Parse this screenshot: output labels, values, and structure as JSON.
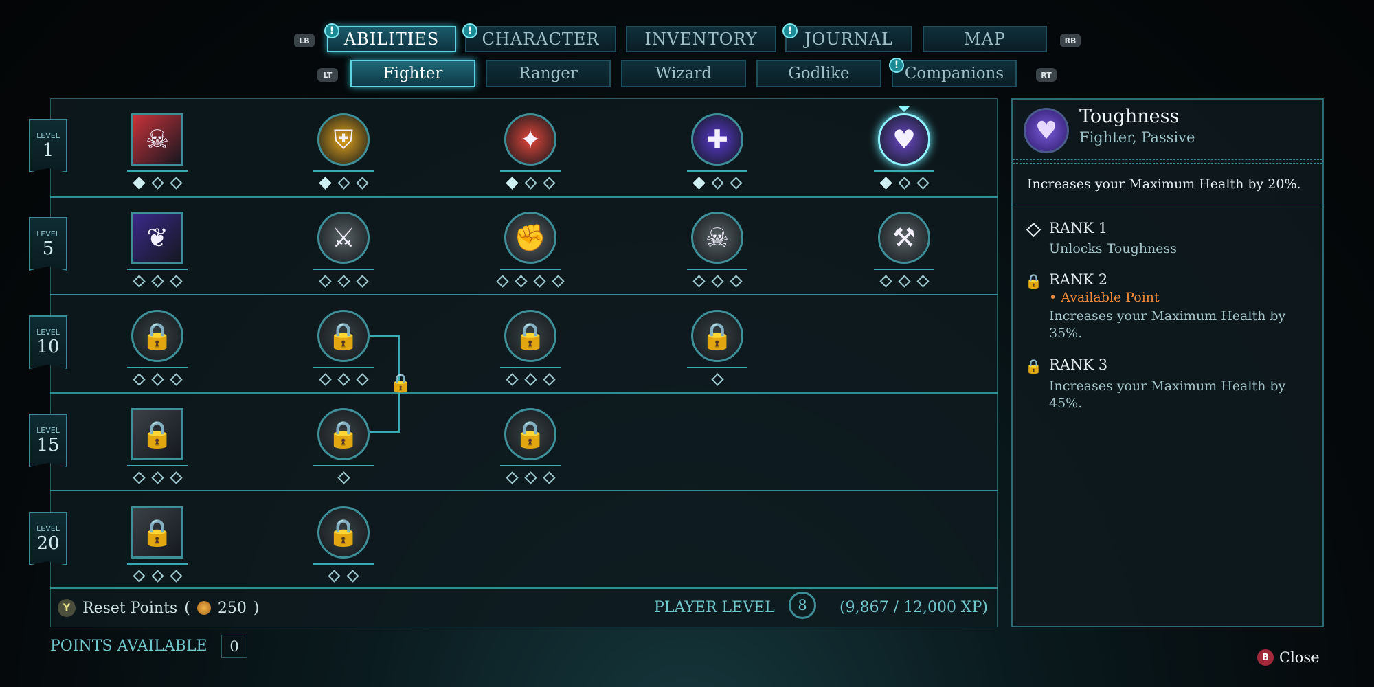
{
  "nav": {
    "left_shoulder": "LB",
    "right_shoulder": "RB",
    "left_trigger": "LT",
    "right_trigger": "RT",
    "main_tabs": [
      {
        "label": "ABILITIES",
        "active": true,
        "alert": true
      },
      {
        "label": "CHARACTER",
        "active": false,
        "alert": true
      },
      {
        "label": "INVENTORY",
        "active": false,
        "alert": false
      },
      {
        "label": "JOURNAL",
        "active": false,
        "alert": true
      },
      {
        "label": "MAP",
        "active": false,
        "alert": false
      }
    ],
    "sub_tabs": [
      {
        "label": "Fighter",
        "active": true,
        "alert": false
      },
      {
        "label": "Ranger",
        "active": false,
        "alert": false
      },
      {
        "label": "Wizard",
        "active": false,
        "alert": false
      },
      {
        "label": "Godlike",
        "active": false,
        "alert": false
      },
      {
        "label": "Companions",
        "active": false,
        "alert": true
      }
    ],
    "alert_glyph": "!"
  },
  "levels": [
    {
      "label": "LEVEL",
      "value": "1"
    },
    {
      "label": "LEVEL",
      "value": "5"
    },
    {
      "label": "LEVEL",
      "value": "10"
    },
    {
      "label": "LEVEL",
      "value": "15"
    },
    {
      "label": "LEVEL",
      "value": "20"
    }
  ],
  "abilities": [
    {
      "row": 0,
      "col": 0,
      "icon": "demon-mask-icon",
      "shape": "square",
      "locked": false,
      "ranks": 3,
      "filled": 1,
      "color": "#c8323a"
    },
    {
      "row": 0,
      "col": 1,
      "icon": "golden-shield-icon",
      "shape": "circle",
      "locked": false,
      "ranks": 3,
      "filled": 1,
      "color": "#e0a21c"
    },
    {
      "row": 0,
      "col": 2,
      "icon": "shield-bash-icon",
      "shape": "circle",
      "locked": false,
      "ranks": 3,
      "filled": 1,
      "color": "#e0453a"
    },
    {
      "row": 0,
      "col": 3,
      "icon": "purple-crosses-icon",
      "shape": "circle",
      "locked": false,
      "ranks": 3,
      "filled": 1,
      "color": "#5a3ad0"
    },
    {
      "row": 0,
      "col": 4,
      "icon": "heart-icon",
      "shape": "circle",
      "locked": false,
      "ranks": 3,
      "filled": 1,
      "color": "#6a4ac8",
      "selected": true
    },
    {
      "row": 1,
      "col": 0,
      "icon": "purple-beast-icon",
      "shape": "square",
      "locked": false,
      "ranks": 3,
      "filled": 0,
      "color": "#3a2a8a"
    },
    {
      "row": 1,
      "col": 1,
      "icon": "axe-cleave-icon",
      "shape": "circle",
      "locked": false,
      "ranks": 3,
      "filled": 0,
      "color": "#5a6266"
    },
    {
      "row": 1,
      "col": 2,
      "icon": "fist-icon",
      "shape": "circle",
      "locked": false,
      "ranks": 4,
      "filled": 0,
      "color": "#5a6266"
    },
    {
      "row": 1,
      "col": 3,
      "icon": "skull-icon",
      "shape": "circle",
      "locked": false,
      "ranks": 3,
      "filled": 0,
      "color": "#5a6266"
    },
    {
      "row": 1,
      "col": 4,
      "icon": "war-axe-icon",
      "shape": "circle",
      "locked": false,
      "ranks": 3,
      "filled": 0,
      "color": "#5a6266"
    },
    {
      "row": 2,
      "col": 0,
      "icon": "lock-icon",
      "shape": "circle",
      "locked": true,
      "ranks": 3,
      "filled": 0,
      "color": "#3a4246"
    },
    {
      "row": 2,
      "col": 1,
      "icon": "lock-icon",
      "shape": "circle",
      "locked": true,
      "ranks": 3,
      "filled": 0,
      "color": "#3a4246"
    },
    {
      "row": 2,
      "col": 2,
      "icon": "lock-icon",
      "shape": "circle",
      "locked": true,
      "ranks": 3,
      "filled": 0,
      "color": "#3a4246"
    },
    {
      "row": 2,
      "col": 3,
      "icon": "lock-icon",
      "shape": "circle",
      "locked": true,
      "ranks": 1,
      "filled": 0,
      "color": "#3a4246"
    },
    {
      "row": 3,
      "col": 0,
      "icon": "lock-icon",
      "shape": "square",
      "locked": true,
      "ranks": 3,
      "filled": 0,
      "color": "#3a4246"
    },
    {
      "row": 3,
      "col": 1,
      "icon": "lock-icon",
      "shape": "circle",
      "locked": true,
      "ranks": 1,
      "filled": 0,
      "color": "#3a4246"
    },
    {
      "row": 3,
      "col": 2,
      "icon": "lock-icon",
      "shape": "circle",
      "locked": true,
      "ranks": 3,
      "filled": 0,
      "color": "#3a4246"
    },
    {
      "row": 4,
      "col": 0,
      "icon": "lock-icon",
      "shape": "square",
      "locked": true,
      "ranks": 3,
      "filled": 0,
      "color": "#3a4246"
    },
    {
      "row": 4,
      "col": 1,
      "icon": "lock-icon",
      "shape": "circle",
      "locked": true,
      "ranks": 2,
      "filled": 0,
      "color": "#3a4246"
    }
  ],
  "footer": {
    "reset_button_glyph": "Y",
    "reset_label": "Reset Points",
    "reset_cost": "250",
    "player_level_label": "PLAYER LEVEL",
    "player_level": "8",
    "xp": "(9,867 / 12,000 XP)",
    "points_available_label": "POINTS AVAILABLE",
    "points_available": "0",
    "close_button_glyph": "B",
    "close_label": "Close"
  },
  "detail": {
    "icon": "heart-icon",
    "title": "Toughness",
    "subtitle": "Fighter, Passive",
    "description": "Increases your Maximum Health by 20%.",
    "ranks": [
      {
        "label": "RANK 1",
        "text": "Unlocks Toughness",
        "state": "unlocked",
        "note": ""
      },
      {
        "label": "RANK 2",
        "text": "Increases your Maximum Health by 35%.",
        "state": "locked",
        "note": "• Available Point"
      },
      {
        "label": "RANK 3",
        "text": "Increases your Maximum Health by 45%.",
        "state": "locked",
        "note": ""
      }
    ]
  }
}
